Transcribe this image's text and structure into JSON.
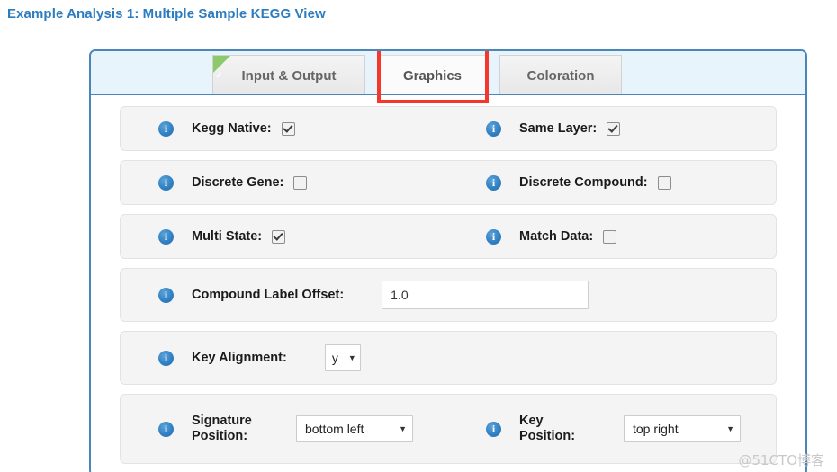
{
  "page": {
    "title": "Example Analysis 1: Multiple Sample KEGG View",
    "watermark": "@51CTO博客",
    "accent_blue": "#4a86b8",
    "title_color": "#2c7cc0",
    "highlight_color": "#f6372c",
    "ribbon_color": "#8cc96a"
  },
  "tabs": [
    {
      "label": "Input & Output",
      "active": false,
      "completed": true,
      "check_glyph": "✓"
    },
    {
      "label": "Graphics",
      "active": true,
      "completed": false,
      "highlighted": true
    },
    {
      "label": "Coloration",
      "active": false,
      "completed": false
    }
  ],
  "form": {
    "rows": [
      {
        "fields": [
          {
            "label": "Kegg Native:",
            "type": "checkbox",
            "checked": true,
            "info": "info-icon"
          },
          {
            "label": "Same Layer:",
            "type": "checkbox",
            "checked": true,
            "info": "info-icon"
          }
        ]
      },
      {
        "fields": [
          {
            "label": "Discrete Gene:",
            "type": "checkbox",
            "checked": false,
            "info": "info-icon"
          },
          {
            "label": "Discrete Compound:",
            "type": "checkbox",
            "checked": false,
            "info": "info-icon"
          }
        ]
      },
      {
        "fields": [
          {
            "label": "Multi State:",
            "type": "checkbox",
            "checked": true,
            "info": "info-icon"
          },
          {
            "label": "Match Data:",
            "type": "checkbox",
            "checked": false,
            "info": "info-icon"
          }
        ]
      },
      {
        "fields": [
          {
            "label": "Compound Label Offset:",
            "type": "text",
            "value": "1.0",
            "placeholder": "",
            "info": "info-icon"
          }
        ]
      },
      {
        "fields": [
          {
            "label": "Key Alignment:",
            "type": "select",
            "value": "y",
            "info": "info-icon"
          }
        ]
      },
      {
        "fields": [
          {
            "label": "Signature Position:",
            "type": "select",
            "value": "bottom left",
            "info": "info-icon"
          },
          {
            "label": "Key Position:",
            "type": "select",
            "value": "top right",
            "info": "info-icon"
          }
        ]
      }
    ]
  }
}
